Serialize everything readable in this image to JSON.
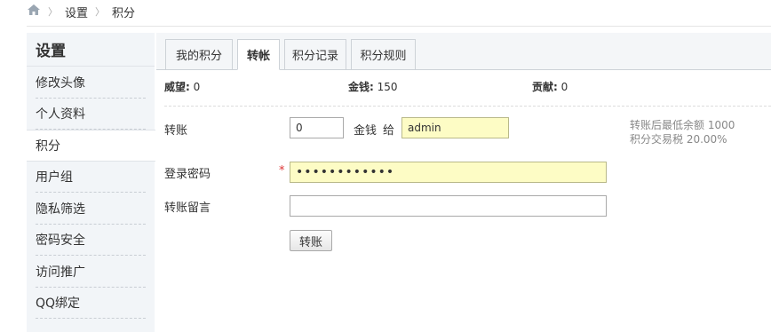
{
  "breadcrumb": {
    "items": [
      "设置",
      "积分"
    ]
  },
  "sidebar": {
    "title": "设置",
    "items": [
      {
        "label": "修改头像"
      },
      {
        "label": "个人资料"
      },
      {
        "label": "积分"
      },
      {
        "label": "用户组"
      },
      {
        "label": "隐私筛选"
      },
      {
        "label": "密码安全"
      },
      {
        "label": "访问推广"
      },
      {
        "label": "QQ绑定"
      }
    ],
    "active_item": "积分"
  },
  "tabs": [
    {
      "label": "我的积分"
    },
    {
      "label": "转帐"
    },
    {
      "label": "积分记录"
    },
    {
      "label": "积分规则"
    }
  ],
  "active_tab": "转帐",
  "stats": [
    {
      "label": "威望:",
      "value": "0"
    },
    {
      "label": "金钱:",
      "value": "150"
    },
    {
      "label": "贡献:",
      "value": "0"
    }
  ],
  "form": {
    "transfer": {
      "label": "转账",
      "amount_value": "0",
      "unit": "金钱",
      "to_label": "给",
      "recipient_value": "admin",
      "hint_min_balance": "转账后最低余额 1000",
      "hint_tax": "积分交易税 20.00%"
    },
    "password": {
      "label": "登录密码",
      "required_mark": "*",
      "masked_value": "••••••••••••"
    },
    "message": {
      "label": "转账留言",
      "value": ""
    },
    "submit_label": "转账"
  },
  "colors": {
    "sidebar_bg": "#f2f5f8",
    "input_highlight": "#fdfcc5",
    "required_mark": "#dd3333"
  }
}
